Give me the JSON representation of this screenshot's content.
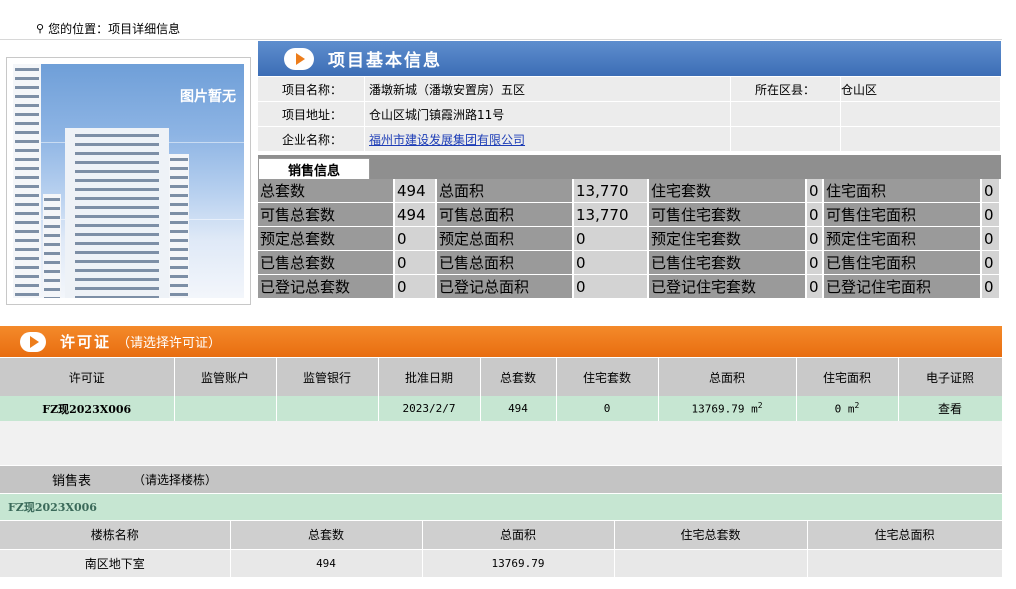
{
  "breadcrumb": {
    "icon": "key-icon",
    "text": "您的位置：项目详细信息"
  },
  "image_panel": {
    "placeholder": "图片暂无"
  },
  "basic": {
    "title": "项目基本信息",
    "name_label": "项目名称：",
    "name_value": "潘墩新城（潘墩安置房）五区",
    "district_label": "所在区县：",
    "district_value": "仓山区",
    "address_label": "项目地址：",
    "address_value": "仓山区城门镇霞洲路11号",
    "company_label": "企业名称：",
    "company_value": "福州市建设发展集团有限公司"
  },
  "sales_info": {
    "tab_label": "销售信息",
    "rows": [
      [
        "总套数",
        "494",
        "总面积",
        "13,770",
        "住宅套数",
        "0",
        "住宅面积",
        "0"
      ],
      [
        "可售总套数",
        "494",
        "可售总面积",
        "13,770",
        "可售住宅套数",
        "0",
        "可售住宅面积",
        "0"
      ],
      [
        "预定总套数",
        "0",
        "预定总面积",
        "0",
        "预定住宅套数",
        "0",
        "预定住宅面积",
        "0"
      ],
      [
        "已售总套数",
        "0",
        "已售总面积",
        "0",
        "已售住宅套数",
        "0",
        "已售住宅面积",
        "0"
      ],
      [
        "已登记总套数",
        "0",
        "已登记总面积",
        "0",
        "已登记住宅套数",
        "0",
        "已登记住宅面积",
        "0"
      ]
    ]
  },
  "permit": {
    "title": "许可证",
    "hint": "（请选择许可证）",
    "columns": [
      "许可证",
      "监管账户",
      "监管银行",
      "批准日期",
      "总套数",
      "住宅套数",
      "总面积",
      "住宅面积",
      "电子证照"
    ],
    "row": {
      "permit_no": "FZ现2023X006",
      "account": "",
      "bank": "",
      "date": "2023/2/7",
      "total_units": "494",
      "res_units": "0",
      "total_area": "13769.79 m",
      "total_area_unit_exp": "2",
      "res_area": "0 m",
      "res_area_unit_exp": "2",
      "view_label": "查看"
    }
  },
  "sales_table": {
    "title": "销售表",
    "hint": "（请选择楼栋）",
    "selected_permit": "FZ现2023X006",
    "columns": [
      "楼栋名称",
      "总套数",
      "总面积",
      "住宅总套数",
      "住宅总面积"
    ],
    "rows": [
      {
        "name": "南区地下室",
        "total_units": "494",
        "total_area": "13769.79",
        "res_units": "",
        "res_area": ""
      }
    ]
  },
  "colors": {
    "blue_header": "#3c6db5",
    "orange_header": "#e86d10",
    "green_row": "#c6e6d2",
    "link": "#1d3db6"
  }
}
